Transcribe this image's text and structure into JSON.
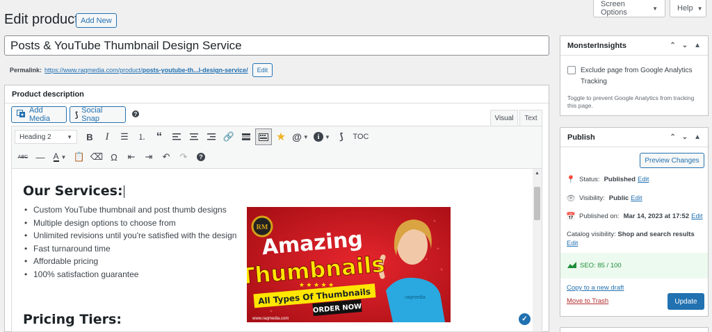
{
  "header": {
    "title": "Edit product",
    "add_new": "Add New",
    "screen_options": "Screen Options",
    "help": "Help"
  },
  "post": {
    "title": "Posts & YouTube Thumbnail Design Service",
    "permalink_label": "Permalink:",
    "permalink_base": "https://www.raqmedia.com/product/",
    "permalink_slug": "posts-youtube-th...l-design-service/",
    "edit_label": "Edit"
  },
  "editor": {
    "box_title": "Product description",
    "add_media": "Add Media",
    "social_snap": "Social Snap",
    "tab_visual": "Visual",
    "tab_text": "Text",
    "format": "Heading 2",
    "toc": "TOC",
    "heading1": "Our Services:",
    "services": [
      "Custom YouTube thumbnail and post thumb designs",
      "Multiple design options to choose from",
      "Unlimited revisions until you're satisfied with the design",
      "Fast turnaround time",
      "Affordable pricing",
      "100% satisfaction guarantee"
    ],
    "heading2": "Pricing Tiers:",
    "image": {
      "line1": "Amazing",
      "line2": "Thumbnails",
      "banner": "All Types Of Thumbnails",
      "cta": "ORDER NOW",
      "url": "www.raqmedia.com",
      "shirt_text": "raqmedia",
      "accent": "#c8161d",
      "text_color": "#ffe600"
    }
  },
  "monsterinsights": {
    "title": "MonsterInsights",
    "checkbox_label": "Exclude page from Google Analytics Tracking",
    "help": "Toggle to prevent Google Analytics from tracking this page."
  },
  "publish": {
    "title": "Publish",
    "preview": "Preview Changes",
    "status_label": "Status:",
    "status_value": "Published",
    "visibility_label": "Visibility:",
    "visibility_value": "Public",
    "published_label": "Published on:",
    "published_value": "Mar 14, 2023 at 17:52",
    "catalog_label": "Catalog visibility:",
    "catalog_value": "Shop and search results",
    "edit": "Edit",
    "seo": "SEO: 85 / 100",
    "copy_draft": "Copy to a new draft",
    "trash": "Move to Trash",
    "update": "Update"
  }
}
